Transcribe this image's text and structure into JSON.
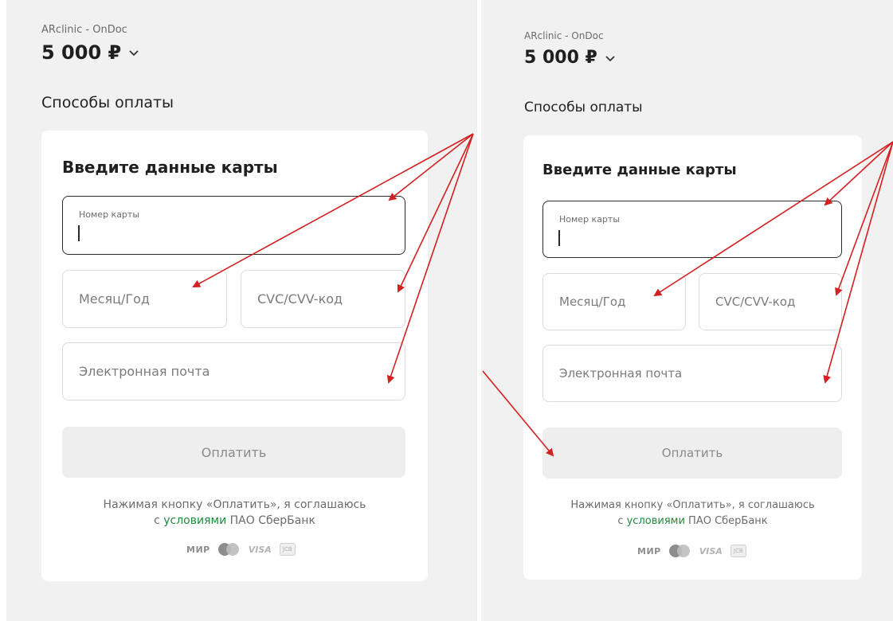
{
  "left": {
    "merchant": "ARclinic - OnDoc",
    "amount": "5 000 ₽",
    "section_title": "Способы оплаты",
    "card_title": "Введите данные карты",
    "card_number_label": "Номер карты",
    "expiry_placeholder": "Месяц/Год",
    "cvc_placeholder": "CVC/CVV-код",
    "email_placeholder": "Электронная почта",
    "pay_label": "Оплатить",
    "terms_line1": "Нажимая кнопку «Оплатить», я соглашаюсь",
    "terms_prefix": "с ",
    "terms_link": "условиями",
    "terms_suffix": " ПАО СберБанк",
    "logo_mir": "МИР",
    "logo_visa": "VISA",
    "logo_jcb": "JCB"
  },
  "right": {
    "merchant": "ARclinic - OnDoc",
    "amount": "5 000 ₽",
    "section_title": "Способы оплаты",
    "card_title": "Введите данные карты",
    "card_number_label": "Номер карты",
    "expiry_placeholder": "Месяц/Год",
    "cvc_placeholder": "CVC/CVV-код",
    "email_placeholder": "Электронная почта",
    "pay_label": "Оплатить",
    "terms_line1": "Нажимая кнопку «Оплатить», я соглашаюсь",
    "terms_prefix": "с ",
    "terms_link": "условиями",
    "terms_suffix": " ПАО СберБанк",
    "logo_mir": "МИР",
    "logo_visa": "VISA",
    "logo_jcb": "JCB"
  },
  "colors": {
    "page_bg": "#f1f1f1",
    "card_bg": "#ffffff",
    "link": "#1e8a3c",
    "annotation_arrow": "#d42020",
    "pay_button_bg": "#eeeeee"
  }
}
